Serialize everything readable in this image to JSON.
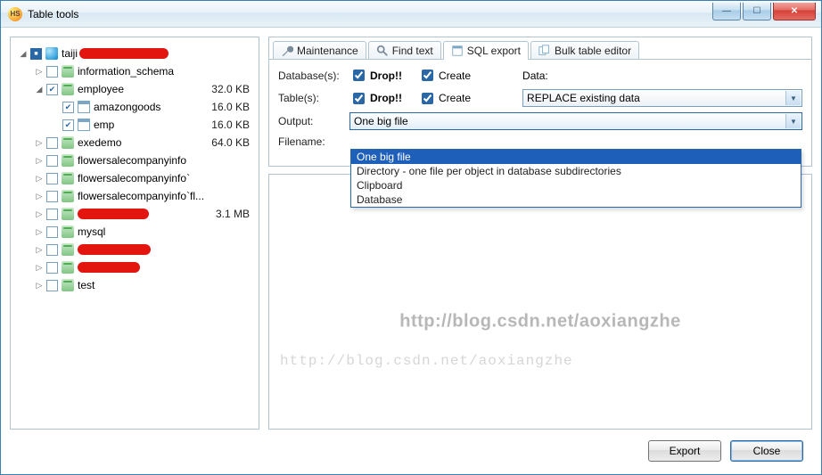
{
  "title": "Table tools",
  "tree": {
    "root": {
      "redact_width": 100
    },
    "items": [
      {
        "label": "information_schema",
        "size": ""
      },
      {
        "label": "employee",
        "size": "32.0 KB"
      },
      {
        "label": "amazongoods",
        "size": "16.0 KB"
      },
      {
        "label": "emp",
        "size": "16.0 KB"
      },
      {
        "label": "exedemo",
        "size": "64.0 KB"
      },
      {
        "label": "flowersalecompanyinfo",
        "size": ""
      },
      {
        "label": "flowersalecompanyinfo`",
        "size": ""
      },
      {
        "label": "flowersalecompanyinfo`fl...",
        "size": ""
      },
      {
        "label": "",
        "size": "3.1 MB"
      },
      {
        "label": "mysql",
        "size": ""
      },
      {
        "label": "",
        "size": ""
      },
      {
        "label": "",
        "size": ""
      },
      {
        "label": "test",
        "size": ""
      }
    ]
  },
  "tabs": {
    "maintenance": "Maintenance",
    "find": "Find text",
    "sql": "SQL export",
    "bulk": "Bulk table editor"
  },
  "form": {
    "databases_label": "Database(s):",
    "tables_label": "Table(s):",
    "drop_label": "Drop!!",
    "create_label": "Create",
    "data_label": "Data:",
    "data_value": "REPLACE existing data",
    "output_label": "Output:",
    "output_value": "One big file",
    "filename_label": "Filename:",
    "dropdown": {
      "opt0": "One big file",
      "opt1": "Directory - one file per object in database subdirectories",
      "opt2": "Clipboard",
      "opt3": "Database"
    }
  },
  "watermark": {
    "big": "http://blog.csdn.net/aoxiangzhe",
    "small": "http://blog.csdn.net/aoxiangzhe"
  },
  "buttons": {
    "export": "Export",
    "close": "Close"
  }
}
